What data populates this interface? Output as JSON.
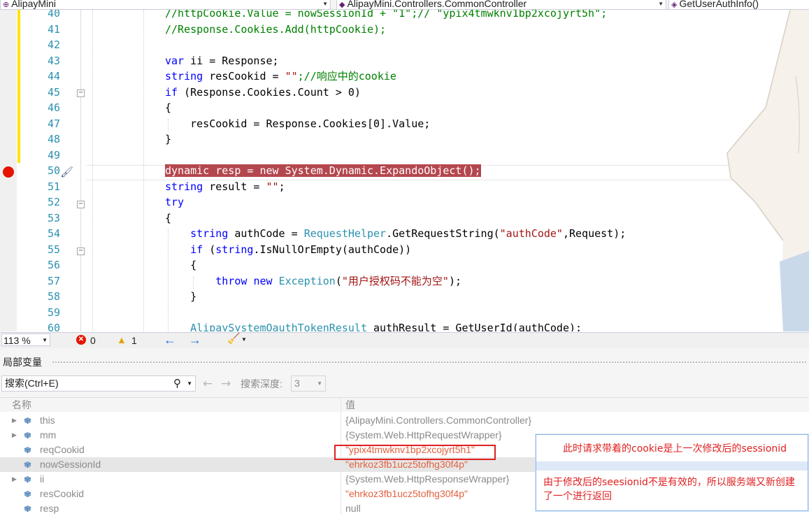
{
  "navbar": {
    "project": "AlipayMini",
    "class": "AlipayMini.Controllers.CommonController",
    "member": "GetUserAuthInfo()"
  },
  "editor": {
    "lines": [
      {
        "num": "40",
        "tokens": [
          {
            "t": "//httpCookie.Value = nowSessionId + \"1\";// \"ypix4tmwknv1bp2xcojyrt5h\";",
            "c": "cm"
          }
        ]
      },
      {
        "num": "41",
        "tokens": [
          {
            "t": "//Response.Cookies.Add(httpCookie);",
            "c": "cm"
          }
        ]
      },
      {
        "num": "42",
        "tokens": []
      },
      {
        "num": "43",
        "tokens": [
          {
            "t": "var",
            "c": "kw"
          },
          {
            "t": " ii = Response;",
            "c": ""
          }
        ]
      },
      {
        "num": "44",
        "tokens": [
          {
            "t": "string",
            "c": "kw"
          },
          {
            "t": " resCookid = ",
            "c": ""
          },
          {
            "t": "\"\"",
            "c": "st"
          },
          {
            "t": ";//响应中的cookie",
            "c": "cm"
          }
        ]
      },
      {
        "num": "45",
        "tokens": [
          {
            "t": "if",
            "c": "kw"
          },
          {
            "t": " (Response.Cookies.Count > 0)",
            "c": ""
          }
        ]
      },
      {
        "num": "46",
        "tokens": [
          {
            "t": "{",
            "c": ""
          }
        ]
      },
      {
        "num": "47",
        "tokens": [
          {
            "t": "    resCookid = Response.Cookies[0].Value;",
            "c": ""
          }
        ]
      },
      {
        "num": "48",
        "tokens": [
          {
            "t": "}",
            "c": ""
          }
        ]
      },
      {
        "num": "49",
        "tokens": []
      },
      {
        "num": "50",
        "tokens": [
          {
            "t": "dynamic resp = new System.Dynamic.ExpandoObject();",
            "c": "hl"
          }
        ]
      },
      {
        "num": "51",
        "tokens": [
          {
            "t": "string",
            "c": "kw"
          },
          {
            "t": " result = ",
            "c": ""
          },
          {
            "t": "\"\"",
            "c": "st"
          },
          {
            "t": ";",
            "c": ""
          }
        ]
      },
      {
        "num": "52",
        "tokens": [
          {
            "t": "try",
            "c": "kw"
          }
        ]
      },
      {
        "num": "53",
        "tokens": [
          {
            "t": "{",
            "c": ""
          }
        ]
      },
      {
        "num": "54",
        "tokens": [
          {
            "t": "    ",
            "c": ""
          },
          {
            "t": "string",
            "c": "kw"
          },
          {
            "t": " authCode = ",
            "c": ""
          },
          {
            "t": "RequestHelper",
            "c": "ty"
          },
          {
            "t": ".GetRequestString(",
            "c": ""
          },
          {
            "t": "\"authCode\"",
            "c": "st"
          },
          {
            "t": ",Request);",
            "c": ""
          }
        ]
      },
      {
        "num": "55",
        "tokens": [
          {
            "t": "    ",
            "c": ""
          },
          {
            "t": "if",
            "c": "kw"
          },
          {
            "t": " (",
            "c": ""
          },
          {
            "t": "string",
            "c": "kw"
          },
          {
            "t": ".IsNullOrEmpty(authCode))",
            "c": ""
          }
        ]
      },
      {
        "num": "56",
        "tokens": [
          {
            "t": "    {",
            "c": ""
          }
        ]
      },
      {
        "num": "57",
        "tokens": [
          {
            "t": "        ",
            "c": ""
          },
          {
            "t": "throw",
            "c": "kw"
          },
          {
            "t": " ",
            "c": ""
          },
          {
            "t": "new",
            "c": "kw"
          },
          {
            "t": " ",
            "c": ""
          },
          {
            "t": "Exception",
            "c": "ty"
          },
          {
            "t": "(",
            "c": ""
          },
          {
            "t": "\"用户授权码不能为空\"",
            "c": "st"
          },
          {
            "t": ");",
            "c": ""
          }
        ]
      },
      {
        "num": "58",
        "tokens": [
          {
            "t": "    }",
            "c": ""
          }
        ]
      },
      {
        "num": "59",
        "tokens": []
      },
      {
        "num": "60",
        "tokens": [
          {
            "t": "    ",
            "c": ""
          },
          {
            "t": "AlipaySystemOauthTokenResult",
            "c": "ty"
          },
          {
            "t": " authResult = GetUserId(authCode);",
            "c": ""
          }
        ]
      }
    ]
  },
  "status": {
    "zoom": "113 %",
    "errors": "0",
    "warnings": "1"
  },
  "locals": {
    "title": "局部变量",
    "search_placeholder": "搜索(Ctrl+E)",
    "depth_label": "搜索深度:",
    "depth_value": "3",
    "col_name": "名称",
    "col_value": "值",
    "rows": [
      {
        "name": "this",
        "value": "{AlipayMini.Controllers.CommonController}",
        "expandable": true,
        "is_string": false
      },
      {
        "name": "mm",
        "value": "{System.Web.HttpRequestWrapper}",
        "expandable": true,
        "is_string": false
      },
      {
        "name": "reqCookid",
        "value": "\"ypix4tmwknv1bp2xcojyrt5h1\"",
        "expandable": false,
        "is_string": true
      },
      {
        "name": "nowSessionId",
        "value": "\"ehrkoz3fb1ucz5tofhg30f4p\"",
        "expandable": false,
        "is_string": true
      },
      {
        "name": "ii",
        "value": "{System.Web.HttpResponseWrapper}",
        "expandable": true,
        "is_string": false
      },
      {
        "name": "resCookid",
        "value": "\"ehrkoz3fb1ucz5tofhg30f4p\"",
        "expandable": false,
        "is_string": true
      },
      {
        "name": "resp",
        "value": "null",
        "expandable": false,
        "is_string": false
      }
    ]
  },
  "annotation": {
    "note1": "此时请求带着的cookie是上一次修改后的sessionid",
    "note2": "由于修改后的seesionid不是有效的，所以服务端又新创建了一个进行返回"
  },
  "colors": {
    "breakpoint": "#e51400",
    "current_line_highlight": "#b4474e",
    "annotation_red": "#e02020",
    "string_value": "#e0623f"
  }
}
